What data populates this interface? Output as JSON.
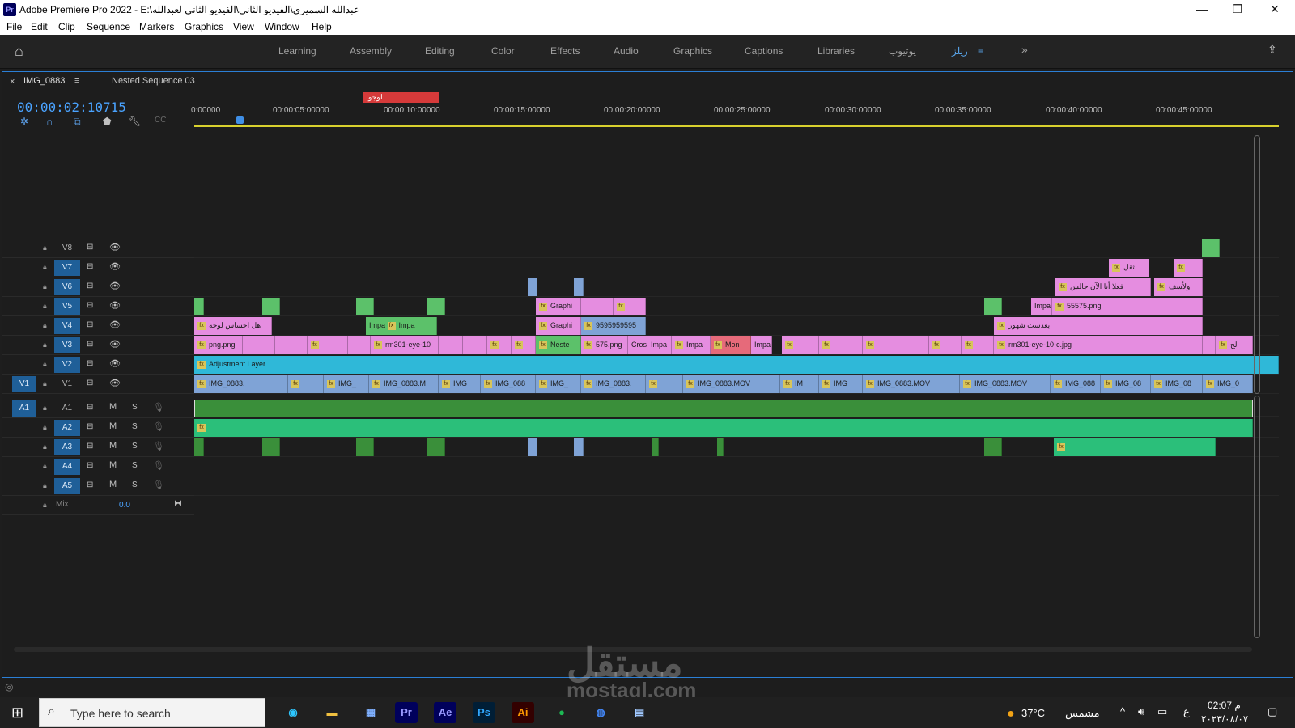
{
  "window": {
    "app_icon": "Pr",
    "title": "Adobe Premiere Pro 2022 - E:\\عبدالله السميري\\الفيديو الثاني\\الفيديو الثاني لعبدالله",
    "min_glyph": "—",
    "max_glyph": "❐",
    "close_glyph": "✕"
  },
  "menu": [
    "File",
    "Edit",
    "Clip",
    "Sequence",
    "Markers",
    "Graphics",
    "View",
    "Window",
    "Help"
  ],
  "workspaces": [
    "Learning",
    "Assembly",
    "Editing",
    "Color",
    "Effects",
    "Audio",
    "Graphics",
    "Captions",
    "Libraries",
    "يوتيوب",
    "ريلز"
  ],
  "workspace_more": "»",
  "timeline": {
    "tab_close": "×",
    "tab_active": "IMG_0883",
    "tab_menu": "≡",
    "tab_other": "Nested Sequence 03",
    "timecode": "00:00:02:10715",
    "ruler_ticks": [
      "0:00000",
      "00:00:05:00000",
      "00:00:10:00000",
      "00:00:15:00000",
      "00:00:20:00000",
      "00:00:25:00000",
      "00:00:30:00000",
      "00:00:35:00000",
      "00:00:40:00000",
      "00:00:45:00000"
    ],
    "work_marker_label": "لوجو",
    "video_tracks": [
      "V8",
      "V7",
      "V6",
      "V5",
      "V4",
      "V3",
      "V2",
      "V1"
    ],
    "audio_tracks": [
      "A1",
      "A2",
      "A3",
      "A4",
      "A5"
    ],
    "src_v": "V1",
    "src_a": "A1",
    "mute_label": "M",
    "solo_label": "S",
    "mix_label": "Mix",
    "mix_value": "0.0",
    "fx": "fx"
  },
  "clips": {
    "v7": [
      "ثقل",
      "fx"
    ],
    "v6": [
      "فعلا أنا الآن جالس",
      "ولأسف"
    ],
    "v5": [
      "Graphi",
      "55575.png",
      "Impa"
    ],
    "v4": [
      "هل احساس لوحة",
      "Impa",
      "Impa",
      "Graphi",
      "9595959595",
      "بعدست شهور"
    ],
    "v3": [
      "png.png",
      "rm301-eye-10",
      "Neste",
      "575.png",
      "Cros",
      "Impa",
      "Impa",
      "Mon",
      "Impa",
      "rm301-eye-10-c.jpg",
      "لج"
    ],
    "v2": [
      "Adjustment Layer"
    ],
    "v1": [
      "IMG_0883.",
      "IMG_",
      "IMG_0883.M",
      "IMG",
      "IMG_088",
      "IMG_",
      "IMG_0883.",
      "IMG_0883.MOV",
      "IM",
      "IMG",
      "IMG_0883.MOV",
      "IMG_0883.MOV",
      "IMG_088",
      "IMG_08",
      "IMG_08",
      "IMG_0"
    ]
  },
  "taskbar": {
    "search_placeholder": "Type here to search",
    "apps": [
      "Pr",
      "Ae",
      "Ps",
      "Ai"
    ],
    "weather": "37°C",
    "weather_text": "مشمس",
    "lang": "ع",
    "time": "02:07 م",
    "date": "٢٠٢٣/٠٨/٠٧"
  },
  "watermark": {
    "arabic": "مستقل",
    "latin": "mostaql.com"
  }
}
